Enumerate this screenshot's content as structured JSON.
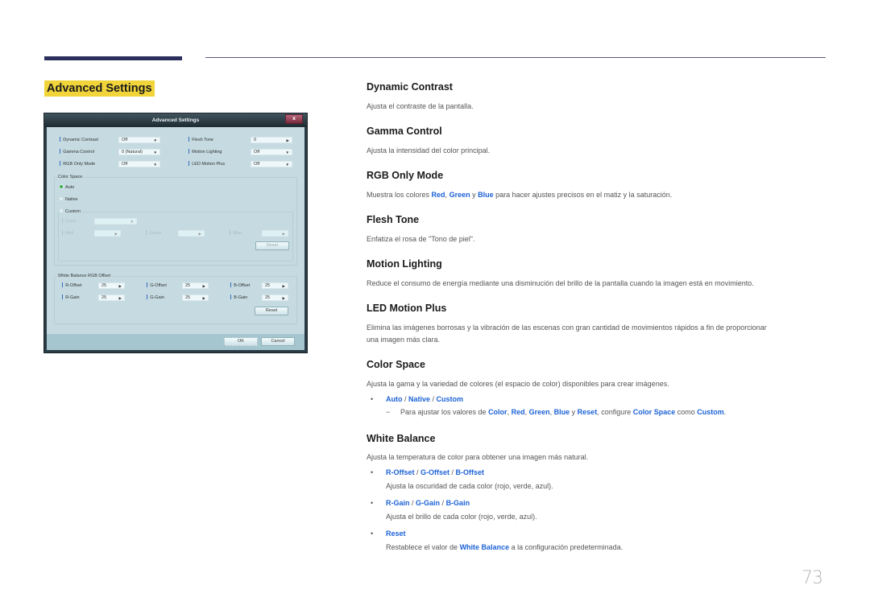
{
  "section_title": "Advanced Settings",
  "dialog": {
    "title": "Advanced Settings",
    "close_label": "x",
    "settings_left": [
      {
        "label": "Dynamic Contrast",
        "value": "Off",
        "control": "dropdown"
      },
      {
        "label": "Gamma Control",
        "value": "0 (Natural)",
        "control": "dropdown"
      },
      {
        "label": "RGB Only Mode",
        "value": "Off",
        "control": "dropdown"
      }
    ],
    "settings_right": [
      {
        "label": "Flesh Tone",
        "value": "0",
        "control": "stepper"
      },
      {
        "label": "Motion Lighting",
        "value": "Off",
        "control": "dropdown"
      },
      {
        "label": "LED Motion Plus",
        "value": "Off",
        "control": "dropdown"
      }
    ],
    "color_space": {
      "legend": "Color Space",
      "options": [
        "Auto",
        "Native",
        "Custom"
      ],
      "selected": "Auto",
      "custom": {
        "color_label": "Color",
        "color_value": "",
        "red_label": "Red",
        "green_label": "Green",
        "blue_label": "Blue",
        "red_value": "",
        "green_value": "",
        "blue_value": "",
        "reset_label": "Reset",
        "enabled": false
      }
    },
    "white_balance": {
      "legend": "White Balance RGB Offset",
      "rows": [
        [
          {
            "label": "R-Offset",
            "value": "25"
          },
          {
            "label": "G-Offset",
            "value": "25"
          },
          {
            "label": "B-Offset",
            "value": "25"
          }
        ],
        [
          {
            "label": "R-Gain",
            "value": "25"
          },
          {
            "label": "G-Gain",
            "value": "25"
          },
          {
            "label": "B-Gain",
            "value": "25"
          }
        ]
      ],
      "reset_label": "Reset"
    },
    "ok_label": "OK",
    "cancel_label": "Cancel"
  },
  "sections": {
    "dynamic_contrast": {
      "title": "Dynamic Contrast",
      "desc": "Ajusta el contraste de la pantalla."
    },
    "gamma_control": {
      "title": "Gamma Control",
      "desc": "Ajusta la intensidad del color principal."
    },
    "rgb_only_mode": {
      "title": "RGB Only Mode",
      "desc_pre": "Muestra los colores ",
      "red": "Red",
      "sep1": ", ",
      "green": "Green",
      "sep2": " y ",
      "blue": "Blue",
      "desc_post": " para hacer ajustes precisos en el matiz y la saturación."
    },
    "flesh_tone": {
      "title": "Flesh Tone",
      "desc": "Enfatiza el rosa de \"Tono de piel\"."
    },
    "motion_lighting": {
      "title": "Motion Lighting",
      "desc": "Reduce el consumo de energía mediante una disminución del brillo de la pantalla cuando la imagen está en movimiento."
    },
    "led_motion_plus": {
      "title": "LED Motion Plus",
      "desc_line1": "Elimina las imágenes borrosas y la vibración de las escenas con gran cantidad de movimientos rápidos a fin de proporcionar",
      "desc_line2": "una imagen más clara."
    },
    "color_space": {
      "title": "Color Space",
      "desc": "Ajusta la gama y la variedad de colores (el espacio de color) disponibles para crear imágenes.",
      "bullet": {
        "auto": "Auto",
        "native": "Native",
        "custom": "Custom",
        "slash": " / "
      },
      "note": {
        "pre": "Para ajustar los valores de ",
        "color": "Color",
        "red": "Red",
        "green": "Green",
        "blue": "Blue",
        "reset": "Reset",
        "comma": ", ",
        "y": " y ",
        "mid": ", configure ",
        "color_space": "Color Space",
        "como": " como ",
        "custom": "Custom",
        "end": "."
      }
    },
    "white_balance": {
      "title": "White Balance",
      "desc": "Ajusta la temperatura de color para obtener una imagen más natural.",
      "items": [
        {
          "links": [
            "R-Offset",
            "G-Offset",
            "B-Offset"
          ],
          "desc": "Ajusta la oscuridad de cada color (rojo, verde, azul)."
        },
        {
          "links": [
            "R-Gain",
            "G-Gain",
            "B-Gain"
          ],
          "desc": "Ajusta el brillo de cada color (rojo, verde, azul)."
        },
        {
          "links": [
            "Reset"
          ],
          "desc_pre": "Restablece el valor de ",
          "desc_link": "White Balance",
          "desc_post": " a la configuración predeterminada."
        }
      ]
    }
  },
  "page_number": "73",
  "colors": {
    "accent_link": "#1c62d6",
    "title_highlight": "#f0d43a",
    "header_bar": "#2b2f5c"
  }
}
